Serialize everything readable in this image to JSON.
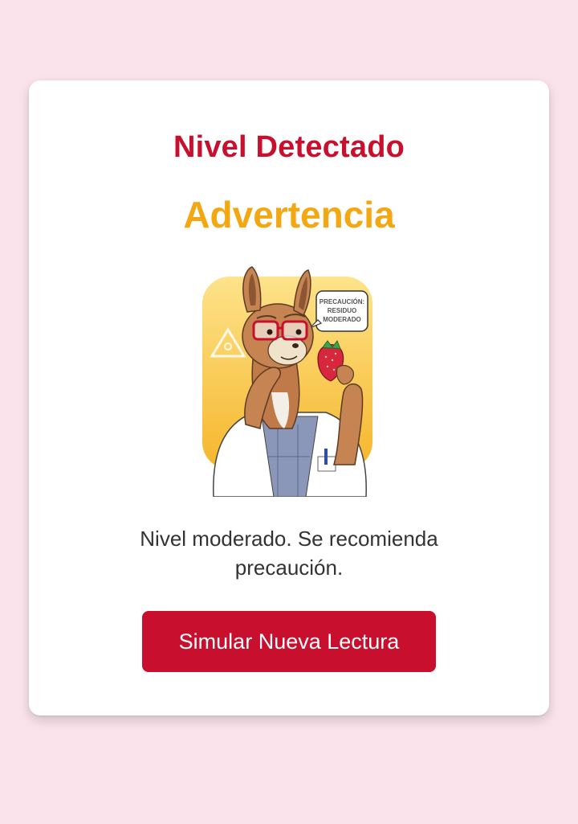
{
  "card": {
    "title": "Nivel Detectado",
    "level": "Advertencia",
    "message": "Nivel moderado. Se recomienda precaución.",
    "button_label": "Simular Nueva Lectura"
  },
  "illustration": {
    "bubble_line1": "PRECAUCIÓN:",
    "bubble_line2": "RESIDUO",
    "bubble_line3": "MODERADO"
  },
  "colors": {
    "background": "#fae3ea",
    "card": "#ffffff",
    "title": "#c8102e",
    "level": "#f3a712",
    "button": "#c8102e",
    "illustration_bg": "#f8c13a"
  }
}
